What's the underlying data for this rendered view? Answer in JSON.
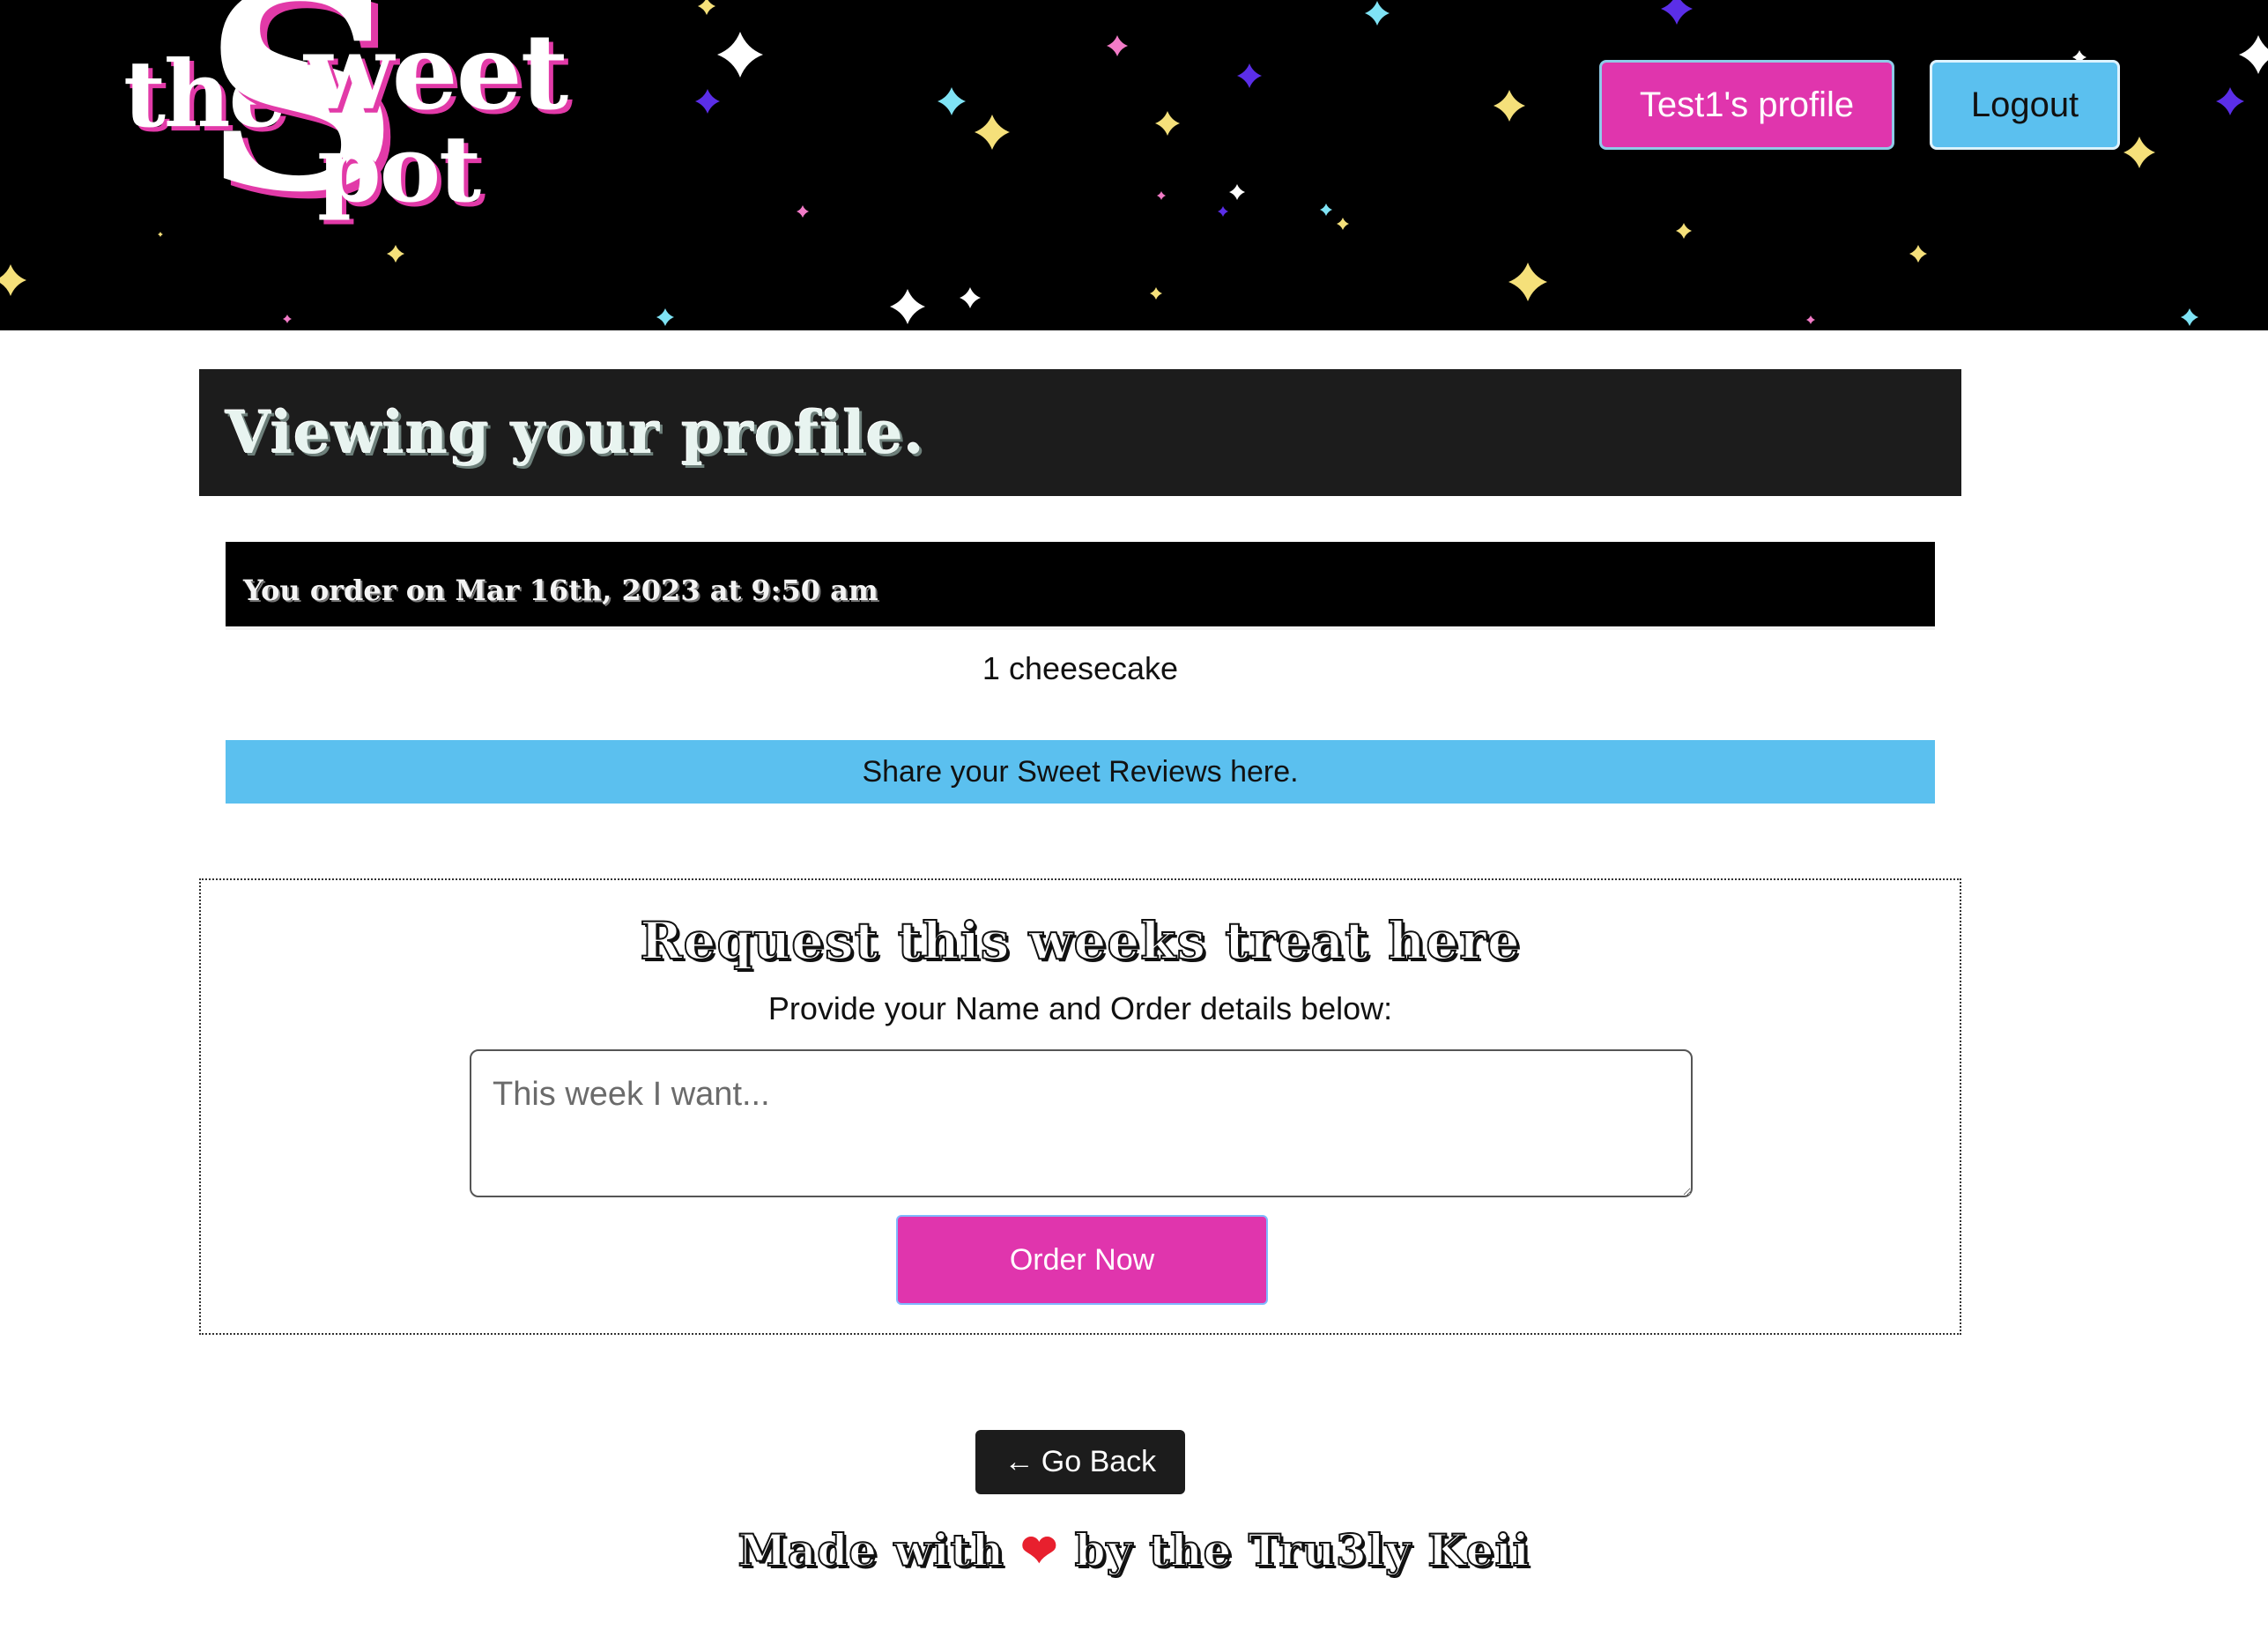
{
  "header": {
    "logo": {
      "the": "the",
      "s": "S",
      "weet": "weet",
      "pot": "pot"
    },
    "profile_button": "Test1's profile",
    "logout_button": "Logout"
  },
  "main": {
    "title": "Viewing your profile.",
    "order": {
      "heading": "You order on Mar 16th, 2023 at 9:50 am",
      "items": "1 cheesecake"
    },
    "review_link": "Share your Sweet Reviews here.",
    "request": {
      "title": "Request this weeks treat here",
      "subtitle": "Provide your Name and Order details below:",
      "placeholder": "This week I want...",
      "submit_label": "Order Now"
    },
    "back_button": {
      "arrow": "←",
      "label": "Go Back"
    }
  },
  "footer": {
    "made_with": "Made with",
    "heart": "❤",
    "by": "by the Tru3ly Keii"
  },
  "colors": {
    "header_bg": "#000000",
    "accent_pink": "#e035ad",
    "accent_blue": "#5bc0ef",
    "dark_bar": "#1c1c1c"
  }
}
